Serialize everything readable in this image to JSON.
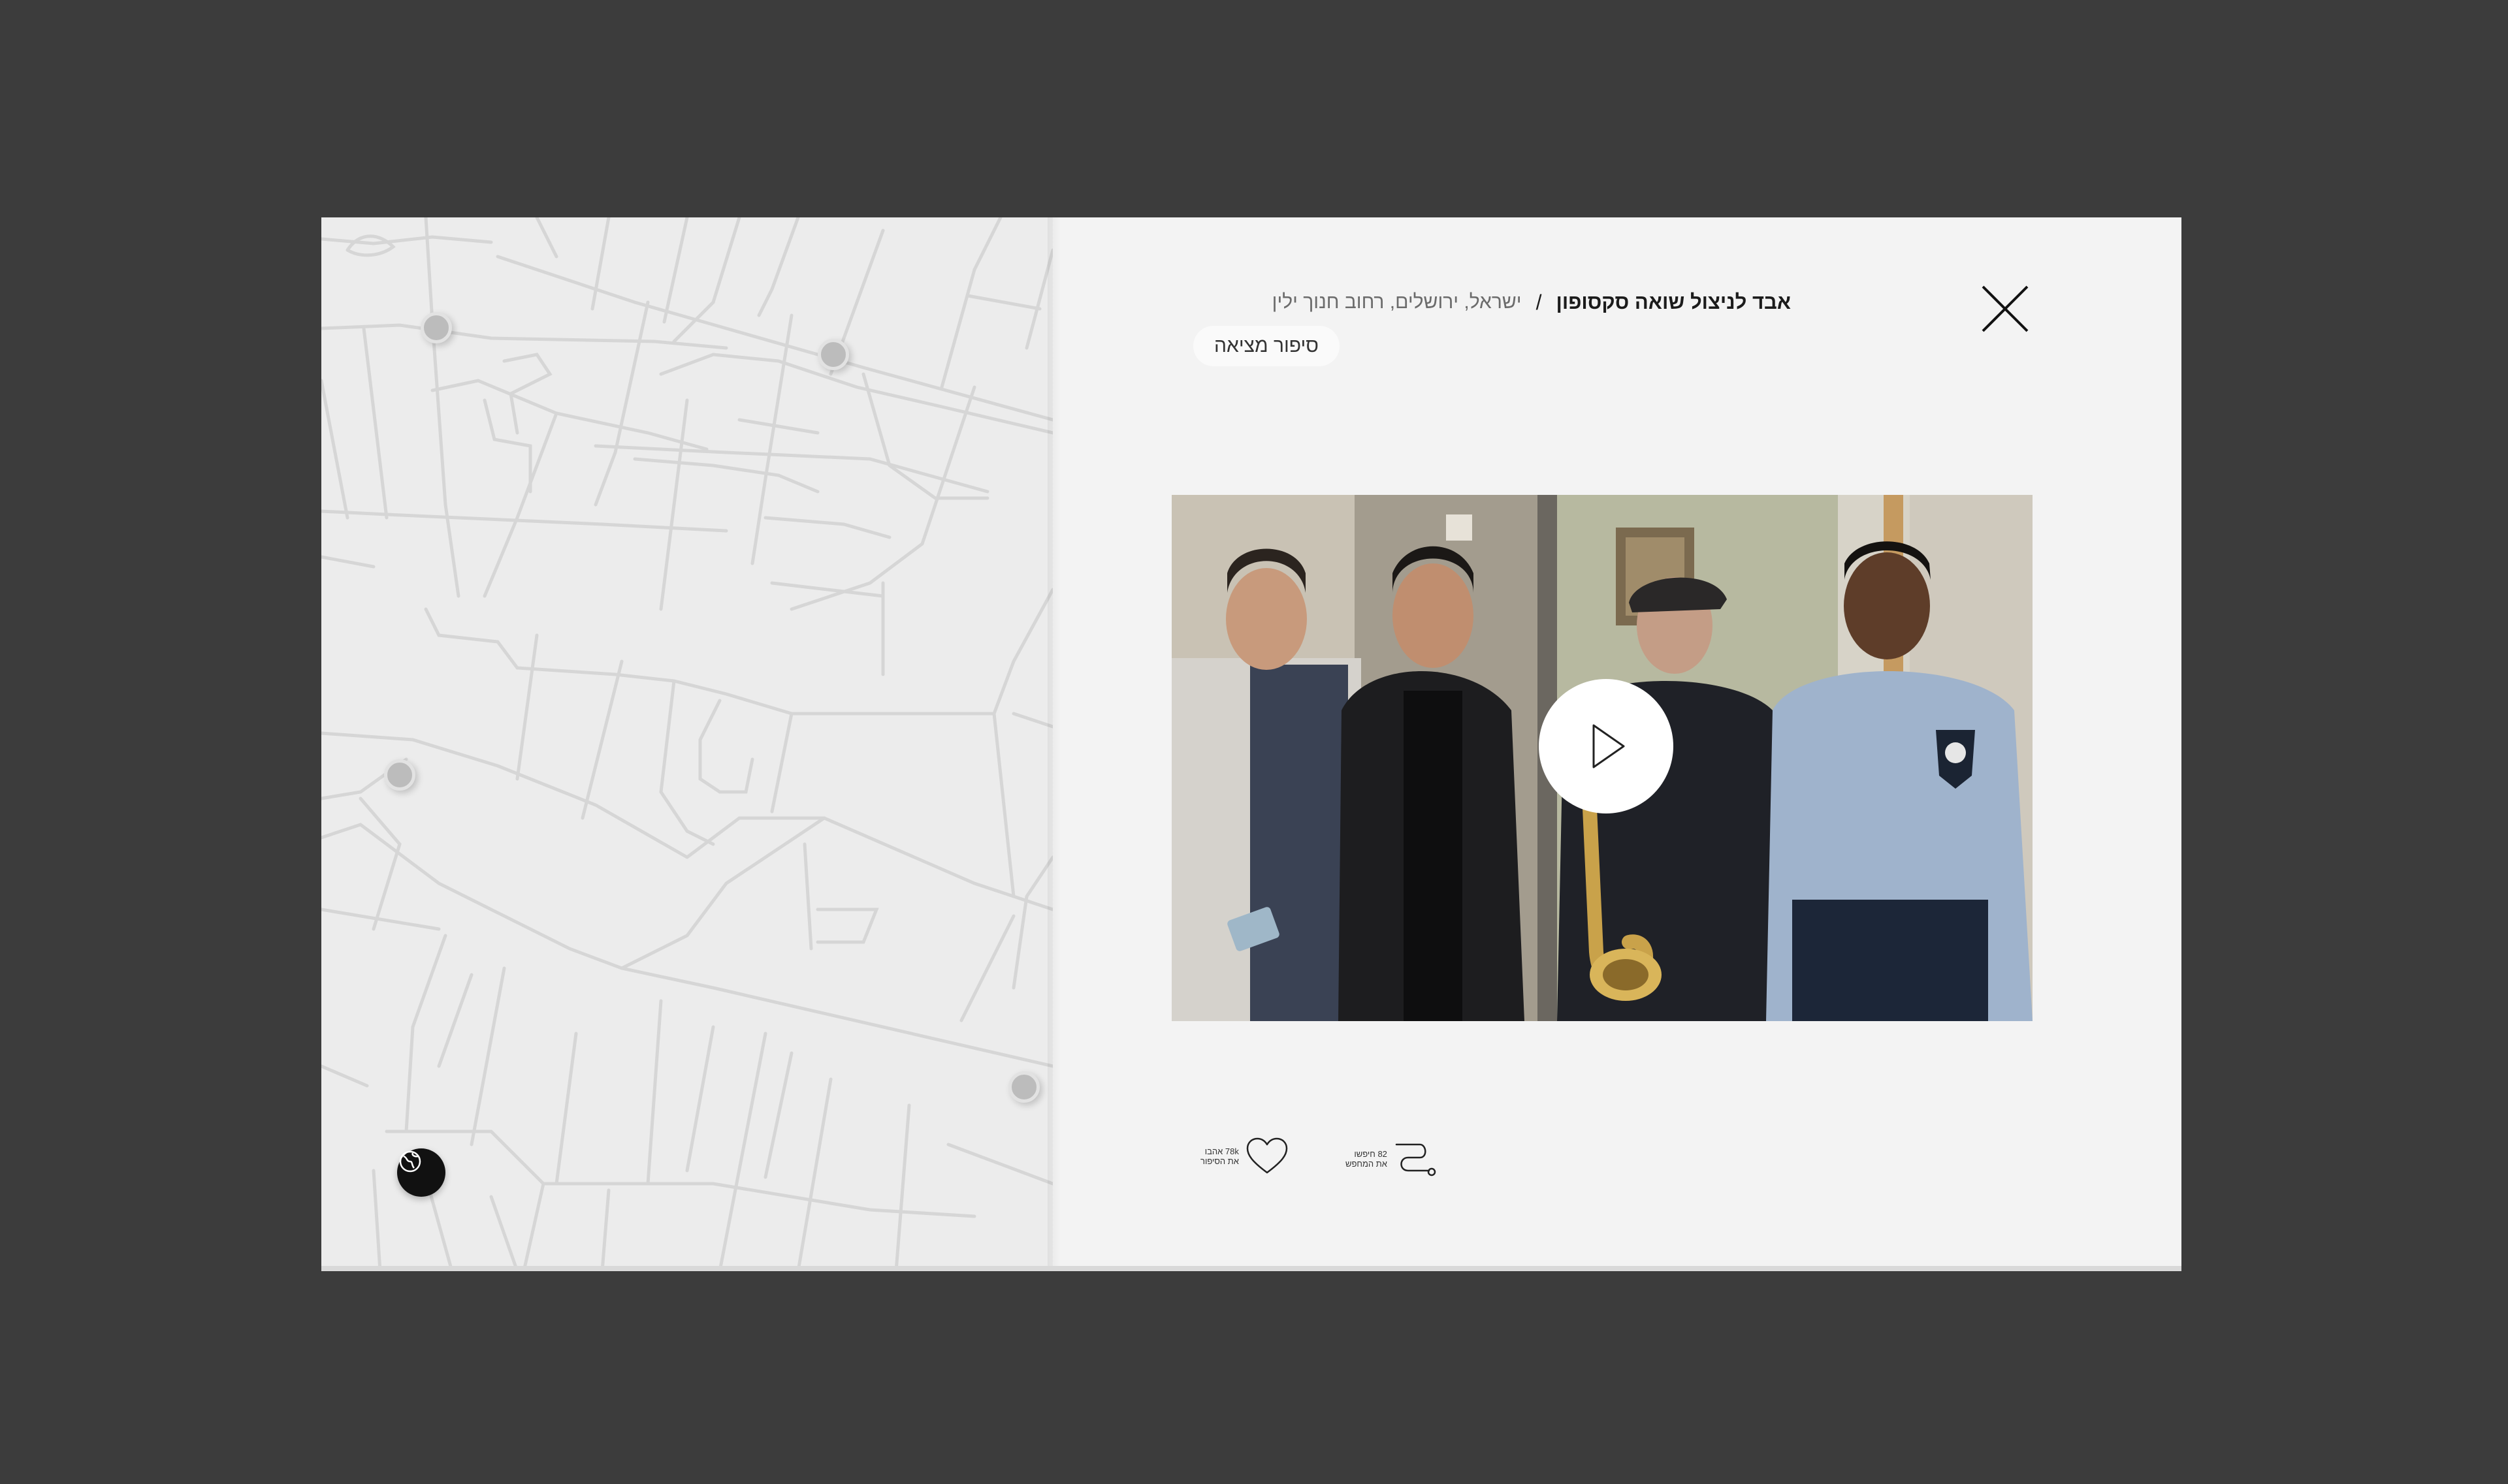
{
  "story": {
    "title": "אבד לניצול שואה סקסופון",
    "separator": "/",
    "location": "ישראל, ירושלים, רחוב חנוך ילין",
    "tag": "סיפור מציאה"
  },
  "stats": {
    "likes": {
      "line1": "78k אהבו",
      "line2": "את הסיפור",
      "icon": "heart-icon"
    },
    "shares": {
      "line1": "82 חיפשו",
      "line2": "את המחפש",
      "icon": "path-icon"
    }
  },
  "colors": {
    "backdrop": "#3c3c3c",
    "modal": "#f3f3f3",
    "map": "#ececec",
    "map_lines": "#d5d5d5",
    "accent": "#111111"
  }
}
